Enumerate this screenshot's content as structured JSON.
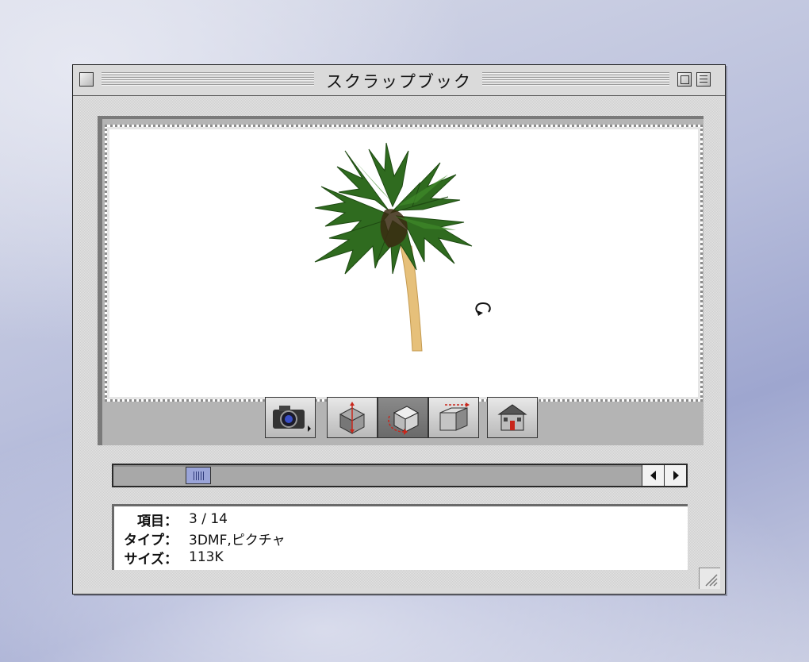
{
  "window": {
    "title": "スクラップブック"
  },
  "toolbar": {
    "tools": [
      {
        "name": "camera-tool"
      },
      {
        "name": "move-tool"
      },
      {
        "name": "rotate-tool"
      },
      {
        "name": "pan-tool"
      },
      {
        "name": "home-tool"
      }
    ],
    "active_tool": "rotate-tool"
  },
  "scroller": {
    "position_fraction": 0.143
  },
  "info": {
    "item_label": "項目：",
    "item_value": "3 / 14",
    "type_label": "タイプ：",
    "type_value": "3DMF,ピクチャ",
    "size_label": "サイズ：",
    "size_value": "113K"
  },
  "colors": {
    "desktop": "#b9bfdc",
    "window_chrome": "#dadada",
    "thumb": "#9aa4d8"
  }
}
